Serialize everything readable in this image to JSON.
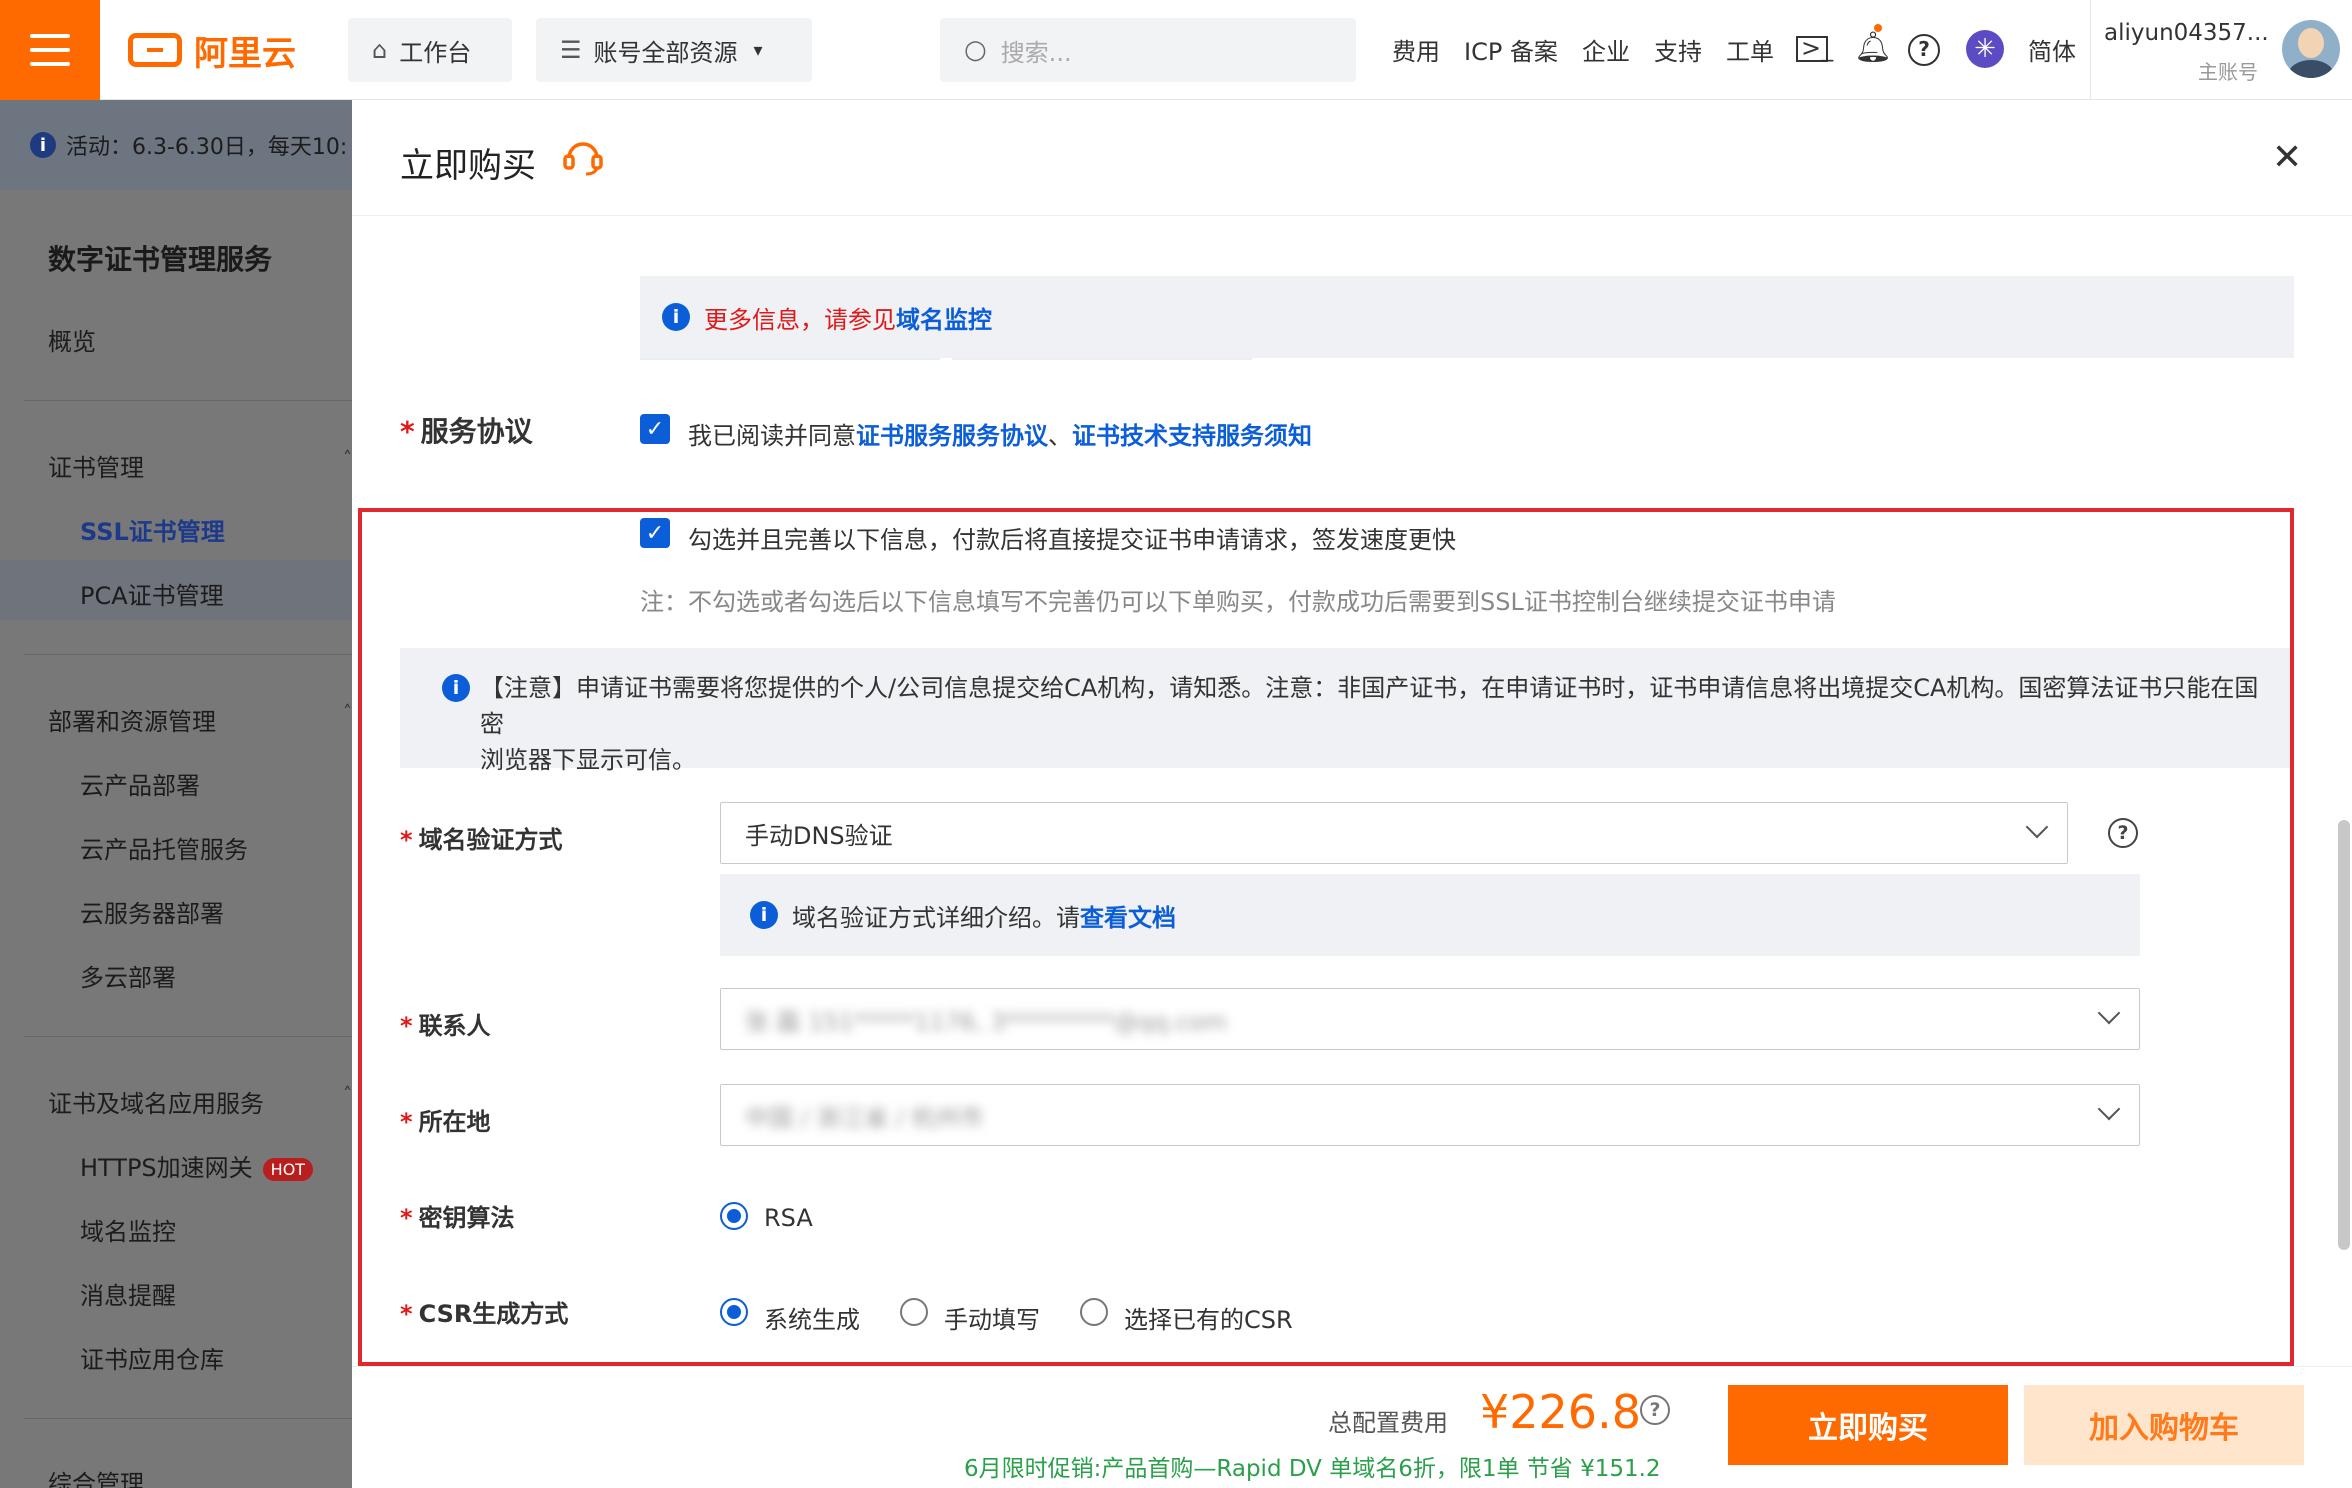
{
  "topbar": {
    "logo_text": "阿里云",
    "workbench": "工作台",
    "resources": "账号全部资源",
    "search_placeholder": "搜索...",
    "nav": [
      "费用",
      "ICP 备案",
      "企业",
      "支持",
      "工单"
    ],
    "lang": "简体",
    "username": "aliyun04357...",
    "usertype": "主账号"
  },
  "sidebar": {
    "notice": "活动：6.3-6.30日，每天10:",
    "title": "数字证书管理服务",
    "overview": "概览",
    "groups": [
      {
        "label": "证书管理",
        "items": [
          "SSL证书管理",
          "PCA证书管理"
        ]
      },
      {
        "label": "部署和资源管理",
        "items": [
          "云产品部署",
          "云产品托管服务",
          "云服务器部署",
          "多云部署"
        ]
      },
      {
        "label": "证书及域名应用服务",
        "items": [
          "HTTPS加速网关",
          "域名监控",
          "消息提醒",
          "证书应用仓库"
        ]
      },
      {
        "label": "综合管理",
        "items": []
      }
    ],
    "hot_badge": "HOT"
  },
  "drawer": {
    "title": "立即购买",
    "more_info_prefix": "更多信息，请参见",
    "more_info_link": "域名监控",
    "agreement_label": "服务协议",
    "agreement_prefix": "我已阅读并同意",
    "agreement_link1": "证书服务服务协议",
    "agreement_sep": "、",
    "agreement_link2": "证书技术支持服务须知",
    "quick_submit": "勾选并且完善以下信息，付款后将直接提交证书申请请求，签发速度更快",
    "note": "注：不勾选或者勾选后以下信息填写不完善仍可以下单购买，付款成功后需要到SSL证书控制台继续提交证书申请",
    "ca_notice_line1": "【注意】申请证书需要将您提供的个人/公司信息提交给CA机构，请知悉。注意：非国产证书，在申请证书时，证书申请信息将出境提交CA机构。国密算法证书只能在国密",
    "ca_notice_line2": "浏览器下显示可信。",
    "domain_verify_label": "域名验证方式",
    "domain_verify_value": "手动DNS验证",
    "verify_info_prefix": "域名验证方式详细介绍。请",
    "verify_info_link": "查看文档",
    "contact_label": "联系人",
    "contact_value": "张 磊  151*****1176, 3*********@qq.com",
    "location_label": "所在地",
    "location_value": "中国 / 浙江省 / 杭州市",
    "key_algo_label": "密钥算法",
    "key_algo_option": "RSA",
    "csr_label": "CSR生成方式",
    "csr_options": [
      "系统生成",
      "手动填写",
      "选择已有的CSR"
    ],
    "csr_selected": 0
  },
  "footer": {
    "total_label": "总配置费用",
    "price": "¥226.8",
    "promo": "6月限时促销:产品首购—Rapid DV 单域名6折，限1单  节省 ¥151.2",
    "buy_now": "立即购买",
    "add_cart": "加入购物车"
  },
  "colors": {
    "brand": "#ff6a00",
    "link": "#0b5ed7",
    "highlight": "#e0282e",
    "promo": "#2aa04a"
  }
}
